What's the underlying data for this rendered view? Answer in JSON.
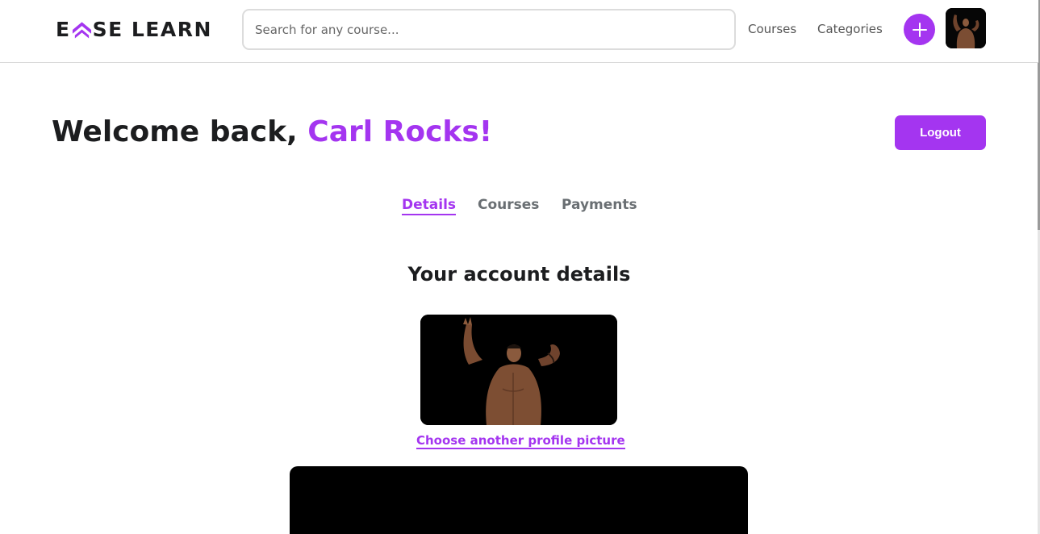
{
  "brand": {
    "logo_left": "E",
    "logo_right": "SE LEARN",
    "accent_color": "#a435f0"
  },
  "header": {
    "search_placeholder": "Search for any course...",
    "nav": {
      "courses": "Courses",
      "categories": "Categories"
    },
    "add_icon": "plus-icon",
    "avatar_icon": "user-avatar"
  },
  "welcome": {
    "prefix": "Welcome back, ",
    "name": "Carl Rocks!"
  },
  "logout_label": "Logout",
  "tabs": [
    {
      "label": "Details",
      "active": true
    },
    {
      "label": "Courses",
      "active": false
    },
    {
      "label": "Payments",
      "active": false
    }
  ],
  "account": {
    "title": "Your account details",
    "change_picture_label": "Choose another profile picture"
  }
}
